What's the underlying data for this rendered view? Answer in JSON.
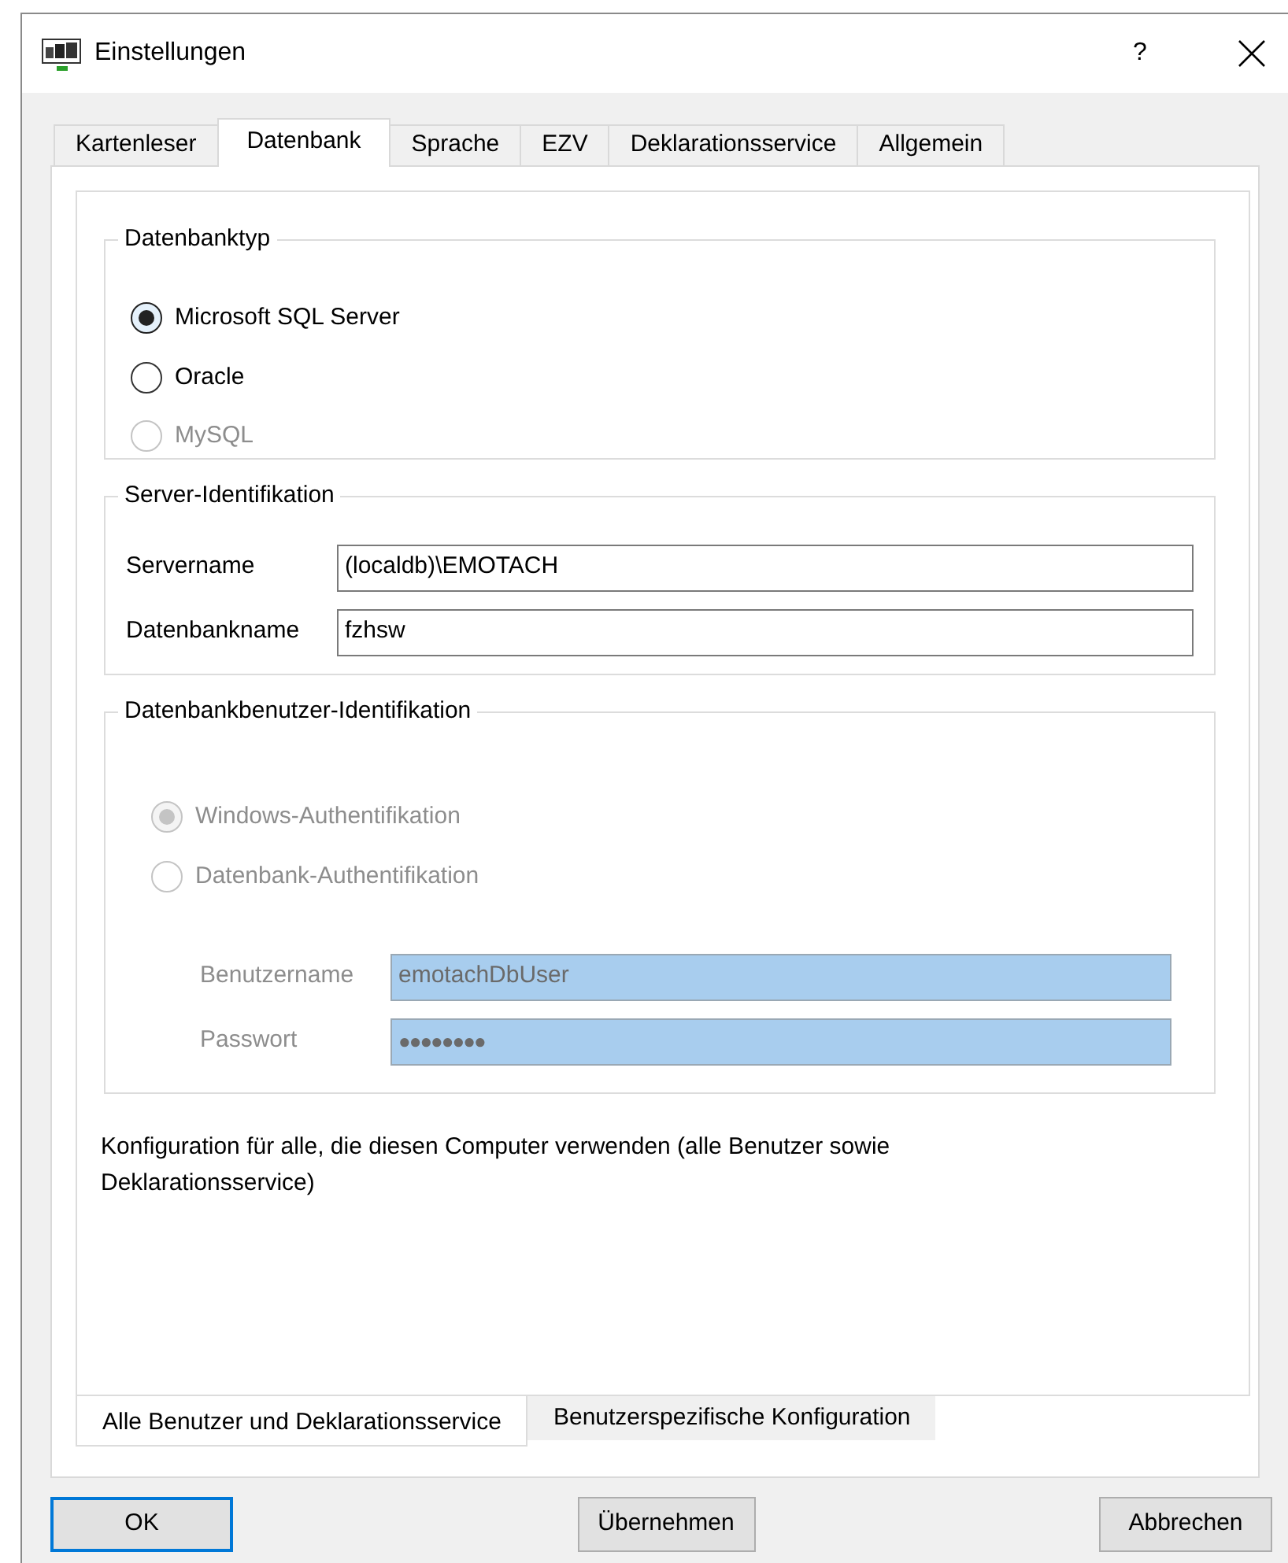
{
  "window": {
    "title": "Einstellungen",
    "help": "?"
  },
  "tabs": [
    {
      "label": "Kartenleser",
      "selected": false
    },
    {
      "label": "Datenbank",
      "selected": true
    },
    {
      "label": "Sprache",
      "selected": false
    },
    {
      "label": "EZV",
      "selected": false
    },
    {
      "label": "Deklarationsservice",
      "selected": false
    },
    {
      "label": "Allgemein",
      "selected": false
    }
  ],
  "database_type": {
    "title": "Datenbanktyp",
    "options": [
      {
        "label": "Microsoft SQL Server",
        "selected": true,
        "disabled": false
      },
      {
        "label": "Oracle",
        "selected": false,
        "disabled": false
      },
      {
        "label": "MySQL",
        "selected": false,
        "disabled": true
      }
    ]
  },
  "server_identification": {
    "title": "Server-Identifikation",
    "fields": [
      {
        "label": "Servername",
        "value": "(localdb)\\EMOTACH"
      },
      {
        "label": "Datenbankname",
        "value": "fzhsw"
      }
    ]
  },
  "db_user_identification": {
    "title": "Datenbankbenutzer-Identifikation",
    "disabled": true,
    "options": [
      {
        "label": "Windows-Authentifikation",
        "selected": true
      },
      {
        "label": "Datenbank-Authentifikation",
        "selected": false
      }
    ],
    "fields": [
      {
        "label": "Benutzername",
        "value": "emotachDbUser",
        "kind": "text"
      },
      {
        "label": "Passwort",
        "value": "●●●●●●●●",
        "kind": "password"
      }
    ]
  },
  "note": "Konfiguration für alle, die diesen Computer verwenden (alle Benutzer sowie Deklarationsservice)",
  "scope_tabs": [
    {
      "label": "Alle Benutzer und Deklarationsservice",
      "selected": true
    },
    {
      "label": "Benutzerspezifische Konfiguration",
      "selected": false
    }
  ],
  "buttons": [
    {
      "label": "OK",
      "default": true
    },
    {
      "label": "Übernehmen",
      "default": false
    },
    {
      "label": "Abbrechen",
      "default": false
    }
  ]
}
